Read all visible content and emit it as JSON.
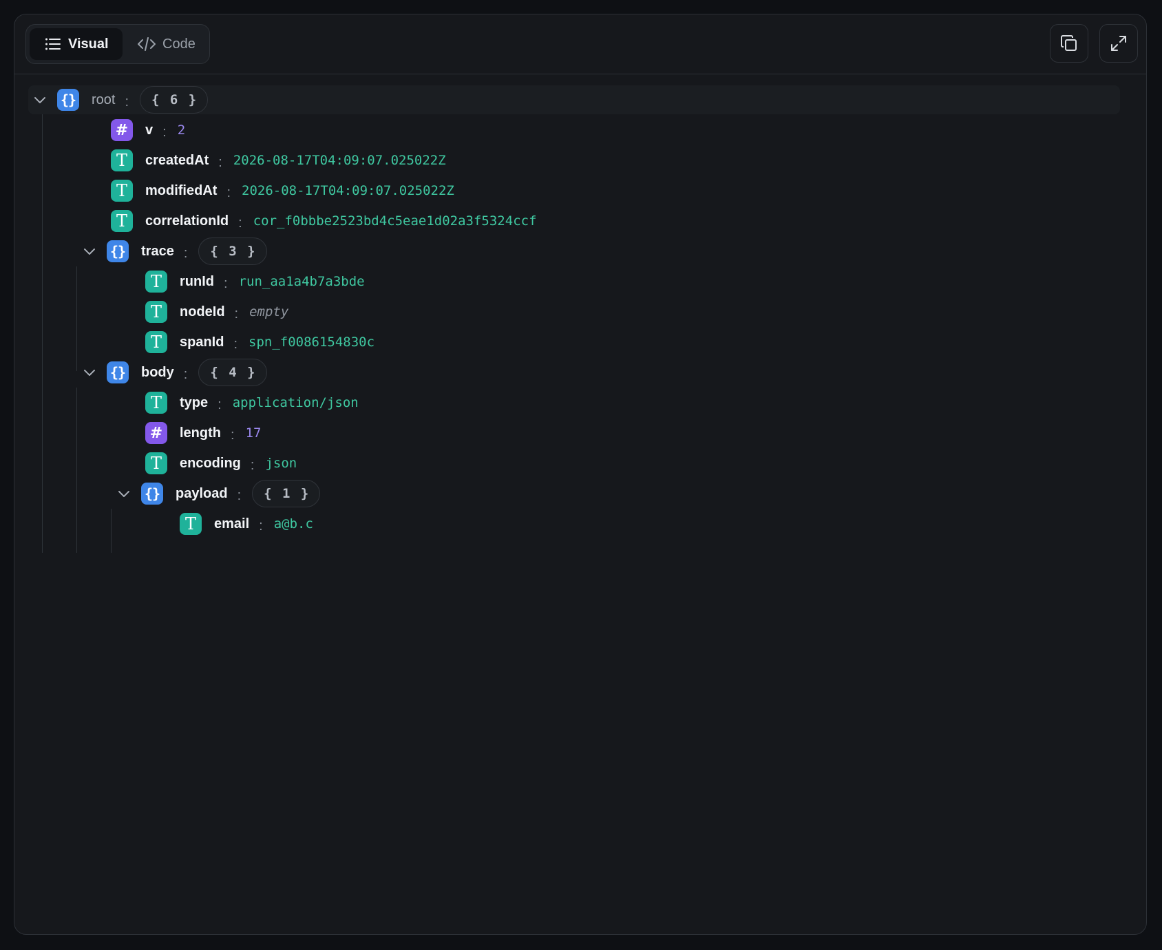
{
  "toolbar": {
    "visual_label": "Visual",
    "code_label": "Code",
    "icons": {
      "visual": "list-icon",
      "code": "code-icon",
      "copy": "copy-icon",
      "expand": "expand-icon"
    }
  },
  "tree": {
    "root": {
      "key": "root",
      "count": "{ 6 }"
    },
    "v": {
      "key": "v",
      "value": "2"
    },
    "createdAt": {
      "key": "createdAt",
      "value": "2026-08-17T04:09:07.025022Z"
    },
    "modifiedAt": {
      "key": "modifiedAt",
      "value": "2026-08-17T04:09:07.025022Z"
    },
    "correlationId": {
      "key": "correlationId",
      "value": "cor_f0bbbe2523bd4c5eae1d02a3f5324ccf"
    },
    "trace": {
      "key": "trace",
      "count": "{ 3 }",
      "runId": {
        "key": "runId",
        "value": "run_aa1a4b7a3bde"
      },
      "nodeId": {
        "key": "nodeId",
        "value": "empty"
      },
      "spanId": {
        "key": "spanId",
        "value": "spn_f0086154830c"
      }
    },
    "body": {
      "key": "body",
      "count": "{ 4 }",
      "type": {
        "key": "type",
        "value": "application/json"
      },
      "length": {
        "key": "length",
        "value": "17"
      },
      "encoding": {
        "key": "encoding",
        "value": "json"
      },
      "payload": {
        "key": "payload",
        "count": "{ 1 }",
        "email": {
          "key": "email",
          "value": "a@b.c"
        }
      }
    }
  },
  "type_badges": {
    "object": "{}",
    "string": "T",
    "number": "#"
  },
  "colors": {
    "background": "#16181c",
    "object_badge": "#3f86e8",
    "string_badge": "#1fb29a",
    "number_badge": "#8358ea",
    "string_value": "#3fc7a0",
    "number_value": "#9a88ee"
  }
}
